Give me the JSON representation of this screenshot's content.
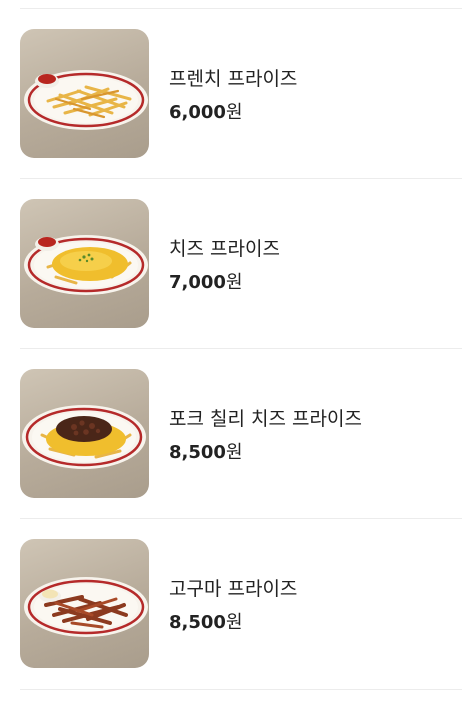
{
  "currency_unit": "원",
  "menu_items": [
    {
      "name": "프렌치 프라이즈",
      "price": "6,000",
      "image_icon": "french-fries-plate"
    },
    {
      "name": "치즈 프라이즈",
      "price": "7,000",
      "image_icon": "cheese-fries-plate"
    },
    {
      "name": "포크 칠리 치즈 프라이즈",
      "price": "8,500",
      "image_icon": "pork-chili-cheese-fries-plate"
    },
    {
      "name": "고구마 프라이즈",
      "price": "8,500",
      "image_icon": "sweet-potato-fries-plate"
    }
  ]
}
